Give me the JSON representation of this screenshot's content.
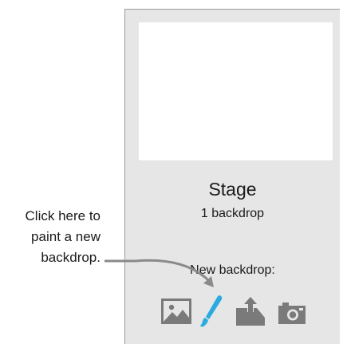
{
  "stage": {
    "title": "Stage",
    "backdrop_count": "1 backdrop"
  },
  "new_backdrop": {
    "label": "New backdrop:",
    "options": [
      {
        "icon": "image-library-icon"
      },
      {
        "icon": "paintbrush-icon"
      },
      {
        "icon": "upload-icon"
      },
      {
        "icon": "camera-icon"
      }
    ]
  },
  "callout": {
    "lines": [
      "Click here to",
      "paint a new",
      "backdrop."
    ]
  },
  "colors": {
    "panel_bg": "#e6e6e6",
    "icon_gray": "#7a7a7a",
    "brush_blue": "#29abe2",
    "arrow_gray": "#8a8a8a"
  }
}
